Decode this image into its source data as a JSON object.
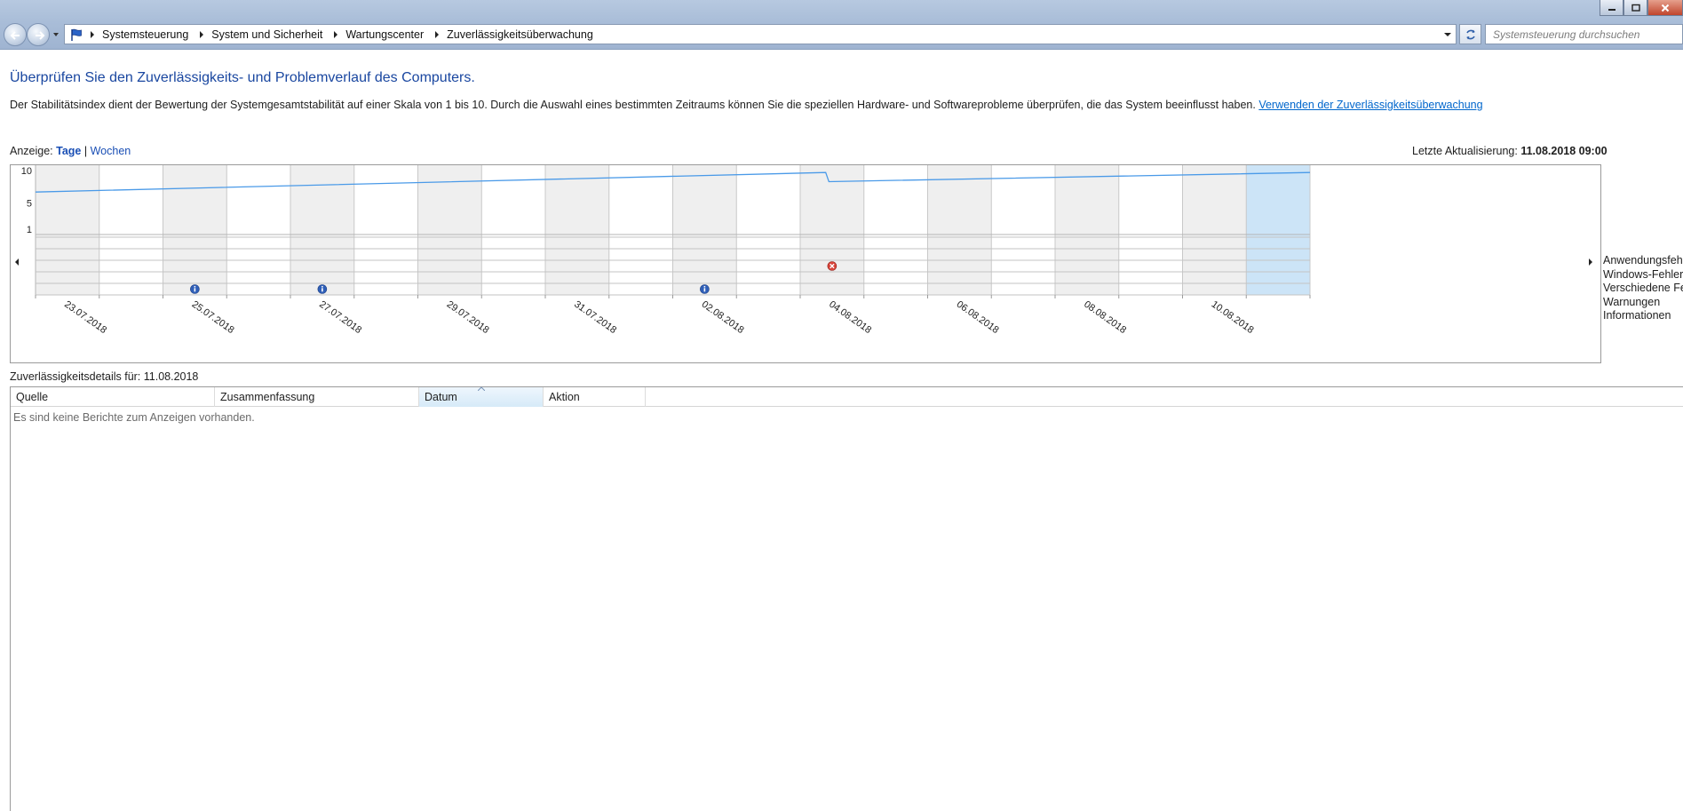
{
  "breadcrumb": [
    {
      "label": "Systemsteuerung"
    },
    {
      "label": "System und Sicherheit"
    },
    {
      "label": "Wartungscenter"
    },
    {
      "label": "Zuverlässigkeitsüberwachung"
    }
  ],
  "search": {
    "placeholder": "Systemsteuerung durchsuchen"
  },
  "page": {
    "title": "Überprüfen Sie den Zuverlässigkeits- und Problemverlauf des Computers.",
    "intro": "Der Stabilitätsindex dient der Bewertung der Systemgesamtstabilität auf einer Skala von 1 bis 10. Durch die Auswahl eines bestimmten Zeitraums können Sie die speziellen Hardware- und Softwareprobleme überprüfen, die das System beeinflusst haben.",
    "intro_link": "Verwenden der Zuverlässigkeitsüberwachung"
  },
  "view": {
    "label": "Anzeige:",
    "days": "Tage",
    "separator": "|",
    "weeks": "Wochen"
  },
  "last_update": {
    "label": "Letzte Aktualisierung:",
    "value": "11.08.2018 09:00"
  },
  "legend": [
    "Anwendungsfehler",
    "Windows-Fehler",
    "Verschiedene Fehler",
    "Warnungen",
    "Informationen"
  ],
  "chart_data": {
    "type": "line",
    "y_ticks": [
      "10",
      "5",
      "1"
    ],
    "ylim": [
      1,
      10
    ],
    "num_columns": 20,
    "x_tick_labels": [
      {
        "column": 0,
        "label": "23.07.2018"
      },
      {
        "column": 2,
        "label": "25.07.2018"
      },
      {
        "column": 4,
        "label": "27.07.2018"
      },
      {
        "column": 6,
        "label": "29.07.2018"
      },
      {
        "column": 8,
        "label": "31.07.2018"
      },
      {
        "column": 10,
        "label": "02.08.2018"
      },
      {
        "column": 12,
        "label": "04.08.2018"
      },
      {
        "column": 14,
        "label": "06.08.2018"
      },
      {
        "column": 16,
        "label": "08.08.2018"
      },
      {
        "column": 18,
        "label": "10.08.2018"
      }
    ],
    "stability_index": [
      {
        "column": 0,
        "value": 6.7
      },
      {
        "column": 12.4,
        "value": 9.7
      },
      {
        "column": 12.45,
        "value": 8.3
      },
      {
        "column": 20,
        "value": 9.7
      }
    ],
    "selected_column": 19,
    "events": [
      {
        "column": 2,
        "row": "Informationen",
        "kind": "info"
      },
      {
        "column": 4,
        "row": "Informationen",
        "kind": "info"
      },
      {
        "column": 10,
        "row": "Informationen",
        "kind": "info"
      },
      {
        "column": 12,
        "row": "Verschiedene Fehler",
        "kind": "error"
      }
    ]
  },
  "details": {
    "label": "Zuverlässigkeitsdetails für: 11.08.2018",
    "columns": [
      "Quelle",
      "Zusammenfassung",
      "Datum",
      "Aktion"
    ],
    "sorted_column": "Datum",
    "empty_message": "Es sind keine Berichte zum Anzeigen vorhanden."
  },
  "colors": {
    "link": "#0066cc",
    "title": "#1a47a0",
    "line": "#4a9ae8",
    "selected_column": "#cce4f7",
    "shaded_column": "#efefef"
  }
}
